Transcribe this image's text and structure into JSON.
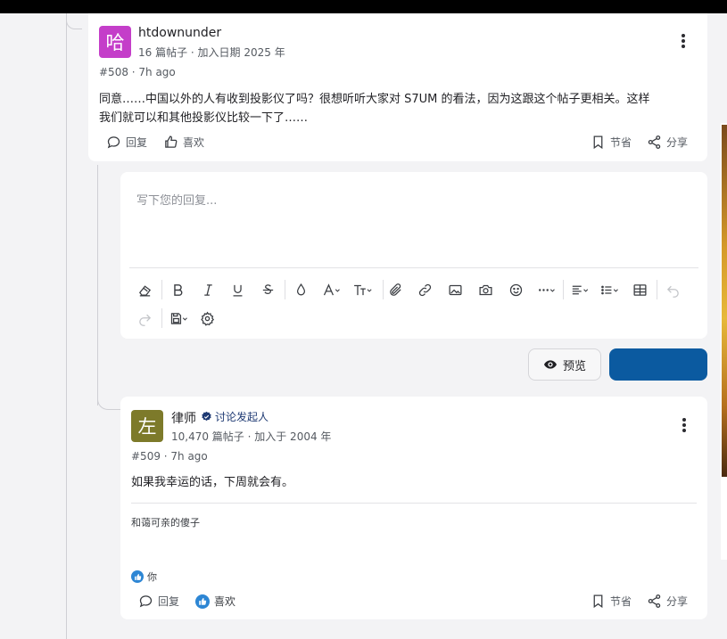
{
  "post1": {
    "avatar_char": "哈",
    "avatar_color": "#c43ec9",
    "username": "htdownunder",
    "meta": "16 篇帖子 · 加入日期 2025 年",
    "postnum": "#508 · 7h ago",
    "body_line1": "同意……中国以外的人有收到投影仪了吗？很想听听大家对 S7UM 的看法，因为这跟这个帖子更相关。这样",
    "body_line2": "我们就可以和其他投影仪比较一下了……",
    "actions": {
      "reply": "回复",
      "like": "喜欢",
      "bookmark": "节省",
      "share": "分享"
    }
  },
  "editor": {
    "placeholder": "写下您的回复..."
  },
  "buttons": {
    "preview": "预览",
    "submit": ""
  },
  "post2": {
    "avatar_char": "左",
    "avatar_color": "#7d7a2a",
    "username": "律师",
    "badge": "讨论发起人",
    "meta": "10,470 篇帖子 · 加入于 2004 年",
    "postnum": "#509 · 7h ago",
    "body": "如果我幸运的话，下周就会有。",
    "signature": "和蔼可亲的傻子",
    "reaction_user": "你",
    "actions": {
      "reply": "回复",
      "like": "喜欢",
      "bookmark": "节省",
      "share": "分享"
    }
  },
  "colors": {
    "accent": "#0b5aa0",
    "like_blue": "#2d86d4"
  }
}
